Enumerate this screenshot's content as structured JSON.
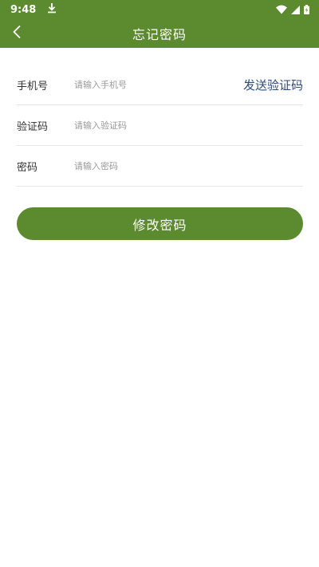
{
  "status_bar": {
    "time": "9:48",
    "download_icon": "download-icon",
    "wifi_icon": "wifi-icon",
    "signal_icon": "signal-icon",
    "battery_icon": "battery-icon"
  },
  "app_bar": {
    "back_icon": "chevron-left-icon",
    "title": "忘记密码",
    "color": "#5b8a2f"
  },
  "form": {
    "phone": {
      "label": "手机号",
      "placeholder": "请输入手机号",
      "value": ""
    },
    "send_code_label": "发送验证码",
    "code": {
      "label": "验证码",
      "placeholder": "请输入验证码",
      "value": ""
    },
    "password": {
      "label": "密码",
      "placeholder": "请输入密码",
      "value": ""
    }
  },
  "submit_label": "修改密码",
  "colors": {
    "primary": "#5b8a2f",
    "link": "#2d4c78",
    "divider": "#e6e6e6"
  }
}
